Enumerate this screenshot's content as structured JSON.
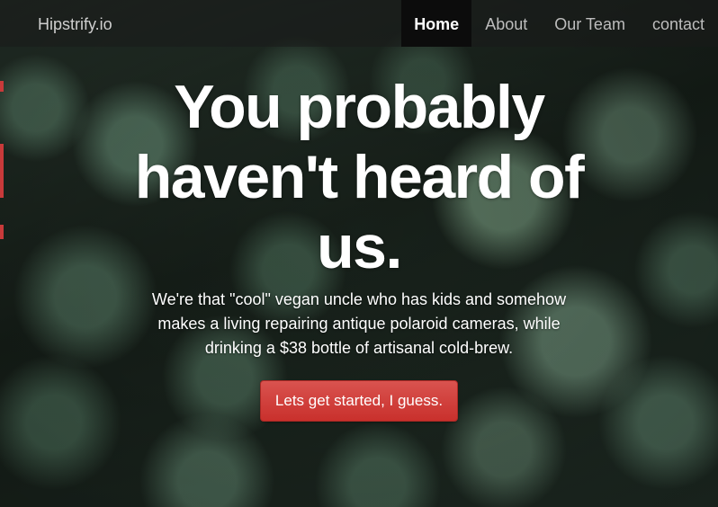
{
  "navbar": {
    "brand": "Hipstrify.io",
    "items": [
      {
        "label": "Home",
        "active": true
      },
      {
        "label": "About",
        "active": false
      },
      {
        "label": "Our Team",
        "active": false
      },
      {
        "label": "contact",
        "active": false
      }
    ]
  },
  "hero": {
    "heading": "You probably haven't heard of us.",
    "lead": "We're that \"cool\" vegan uncle who has kids and somehow makes a living repairing antique polaroid cameras, while drinking a $38 bottle of artisanal cold-brew.",
    "cta_label": "Lets get started, I guess."
  },
  "colors": {
    "cta": "#d9534f",
    "nav_active_bg": "#0c0c0c",
    "background": "#1e2a22"
  }
}
